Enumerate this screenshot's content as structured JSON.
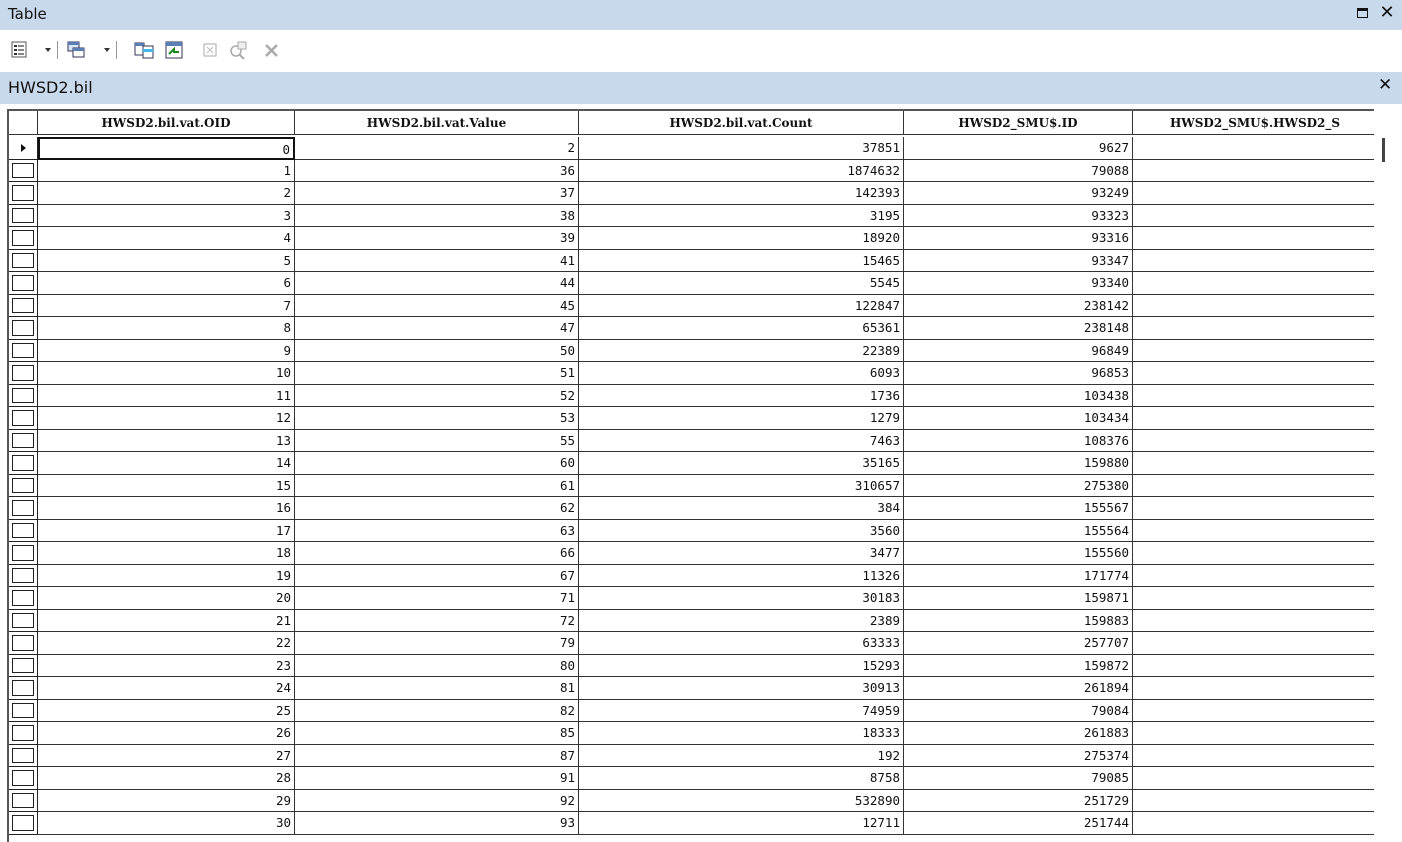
{
  "window": {
    "title": "Table"
  },
  "toolbar": {
    "icons": [
      "table-options-icon",
      "related-tables-icon",
      "select-by-attributes-icon",
      "switch-selection-icon",
      "clear-selection-icon",
      "zoom-to-selected-icon",
      "delete-selected-icon"
    ]
  },
  "tab": {
    "label": "HWSD2.bil"
  },
  "columns": [
    "HWSD2.bil.vat.OID",
    "HWSD2.bil.vat.Value",
    "HWSD2.bil.vat.Count",
    "HWSD2_SMU$.ID",
    "HWSD2_SMU$.HWSD2_S"
  ],
  "rows": [
    [
      "0",
      "2",
      "37851",
      "9627",
      ""
    ],
    [
      "1",
      "36",
      "1874632",
      "79088",
      ""
    ],
    [
      "2",
      "37",
      "142393",
      "93249",
      ""
    ],
    [
      "3",
      "38",
      "3195",
      "93323",
      ""
    ],
    [
      "4",
      "39",
      "18920",
      "93316",
      ""
    ],
    [
      "5",
      "41",
      "15465",
      "93347",
      ""
    ],
    [
      "6",
      "44",
      "5545",
      "93340",
      ""
    ],
    [
      "7",
      "45",
      "122847",
      "238142",
      ""
    ],
    [
      "8",
      "47",
      "65361",
      "238148",
      ""
    ],
    [
      "9",
      "50",
      "22389",
      "96849",
      ""
    ],
    [
      "10",
      "51",
      "6093",
      "96853",
      ""
    ],
    [
      "11",
      "52",
      "1736",
      "103438",
      ""
    ],
    [
      "12",
      "53",
      "1279",
      "103434",
      ""
    ],
    [
      "13",
      "55",
      "7463",
      "108376",
      ""
    ],
    [
      "14",
      "60",
      "35165",
      "159880",
      ""
    ],
    [
      "15",
      "61",
      "310657",
      "275380",
      ""
    ],
    [
      "16",
      "62",
      "384",
      "155567",
      ""
    ],
    [
      "17",
      "63",
      "3560",
      "155564",
      ""
    ],
    [
      "18",
      "66",
      "3477",
      "155560",
      ""
    ],
    [
      "19",
      "67",
      "11326",
      "171774",
      ""
    ],
    [
      "20",
      "71",
      "30183",
      "159871",
      ""
    ],
    [
      "21",
      "72",
      "2389",
      "159883",
      ""
    ],
    [
      "22",
      "79",
      "63333",
      "257707",
      ""
    ],
    [
      "23",
      "80",
      "15293",
      "159872",
      ""
    ],
    [
      "24",
      "81",
      "30913",
      "261894",
      ""
    ],
    [
      "25",
      "82",
      "74959",
      "79084",
      ""
    ],
    [
      "26",
      "85",
      "18333",
      "261883",
      ""
    ],
    [
      "27",
      "87",
      "192",
      "275374",
      ""
    ],
    [
      "28",
      "91",
      "8758",
      "79085",
      ""
    ],
    [
      "29",
      "92",
      "532890",
      "251729",
      ""
    ],
    [
      "30",
      "93",
      "12711",
      "251744",
      ""
    ]
  ]
}
